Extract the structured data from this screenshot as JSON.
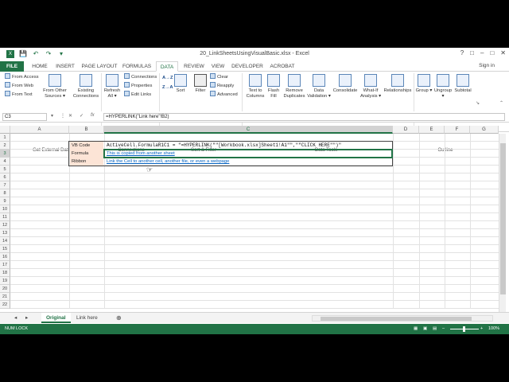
{
  "window": {
    "title": "20_LinkSheetsUsingVisualBasic.xlsx - Excel",
    "controls": [
      "?",
      "□",
      "–",
      "□",
      "✕"
    ]
  },
  "ribbon_tabs": [
    "FILE",
    "HOME",
    "INSERT",
    "PAGE LAYOUT",
    "FORMULAS",
    "DATA",
    "REVIEW",
    "VIEW",
    "DEVELOPER",
    "ACROBAT"
  ],
  "sign_in": "Sign in",
  "ribbon": {
    "get_external": {
      "items": [
        "From Access",
        "From Web",
        "From Text"
      ],
      "other_sources": "From Other Sources ▾",
      "existing": "Existing Connections",
      "label": "Get External Data"
    },
    "connections": {
      "refresh": "Refresh All ▾",
      "items": [
        "Connections",
        "Properties",
        "Edit Links"
      ],
      "label": "Connections"
    },
    "sort_filter": {
      "az": "A→Z",
      "za": "Z→A",
      "sort": "Sort",
      "filter": "Filter",
      "items": [
        "Clear",
        "Reapply",
        "Advanced"
      ],
      "label": "Sort & Filter"
    },
    "data_tools": {
      "items": [
        "Text to Columns",
        "Flash Fill",
        "Remove Duplicates",
        "Data Validation ▾",
        "Consolidate",
        "What-If Analysis ▾",
        "Relationships"
      ],
      "label": "Data Tools"
    },
    "outline": {
      "items": [
        "Group ▾",
        "Ungroup ▾",
        "Subtotal"
      ],
      "label": "Outline"
    }
  },
  "formula_bar": {
    "name_box": "C3",
    "cancel": "✕",
    "enter": "✓",
    "fx": "fx",
    "formula": "=HYPERLINK(\"Link here\"!B2)"
  },
  "columns": [
    "A",
    "B",
    "C",
    "D",
    "E",
    "F",
    "G"
  ],
  "rows": [
    "1",
    "2",
    "3",
    "4",
    "5",
    "6",
    "7",
    "8",
    "9",
    "10",
    "11",
    "12",
    "13",
    "14",
    "15",
    "16",
    "17",
    "18",
    "19",
    "20",
    "21",
    "22"
  ],
  "cells": {
    "b2": "VB Code",
    "c2": "ActiveCell.FormulaR1C1 = \"=HYPERLINK(\"\"[Workbook.xlsx]Sheet1!A1\"\",\"\"CLICK HERE\"\")\"",
    "b3": "Formula",
    "c3": "This is copied from another sheet",
    "b4": "Ribbon",
    "c4": "Link the Cell to another cell, another file, or even a webpage"
  },
  "sheet_tabs": [
    "Original",
    "Link here"
  ],
  "sheet_nav": [
    "◂",
    "▸",
    "⊕"
  ],
  "status": {
    "left": "NUM LOCK",
    "zoom": "100%"
  }
}
